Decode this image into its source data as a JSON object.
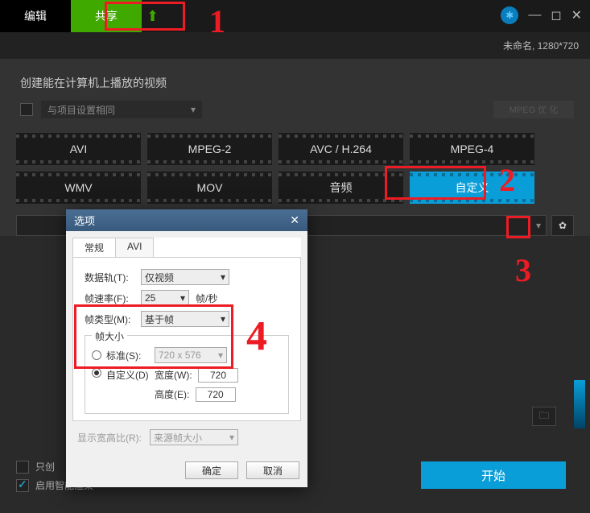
{
  "topbar": {
    "edit_label": "编辑",
    "share_label": "共享"
  },
  "subbar": {
    "status": "未命名, 1280*720"
  },
  "main": {
    "title": "创建能在计算机上播放的视频",
    "project_same_label": "与项目设置相同",
    "mpeg_opt": "MPEG 优 化"
  },
  "formats": [
    "AVI",
    "MPEG-2",
    "AVC / H.264",
    "MPEG-4",
    "WMV",
    "MOV",
    "音频",
    "自定义"
  ],
  "bottom": {
    "only_create": "只创",
    "smart_render": "启用智能渲染",
    "start": "开始"
  },
  "dialog": {
    "title": "选项",
    "tabs": [
      "常规",
      "AVI"
    ],
    "track_label": "数据轨(T):",
    "track_value": "仅视频",
    "fps_label": "帧速率(F):",
    "fps_value": "25",
    "fps_unit": "帧/秒",
    "frametype_label": "帧类型(M):",
    "frametype_value": "基于帧",
    "framesize_legend": "帧大小",
    "standard_label": "标准(S):",
    "standard_value": "720 x 576",
    "custom_label": "自定义(D)",
    "width_label": "宽度(W):",
    "width_value": "720",
    "height_label": "高度(E):",
    "height_value": "720",
    "aspect_label": "显示宽高比(R):",
    "aspect_value": "来源帧大小",
    "ok": "确定",
    "cancel": "取消"
  },
  "annotations": {
    "n1": "1",
    "n2": "2",
    "n3": "3",
    "n4": "4"
  }
}
